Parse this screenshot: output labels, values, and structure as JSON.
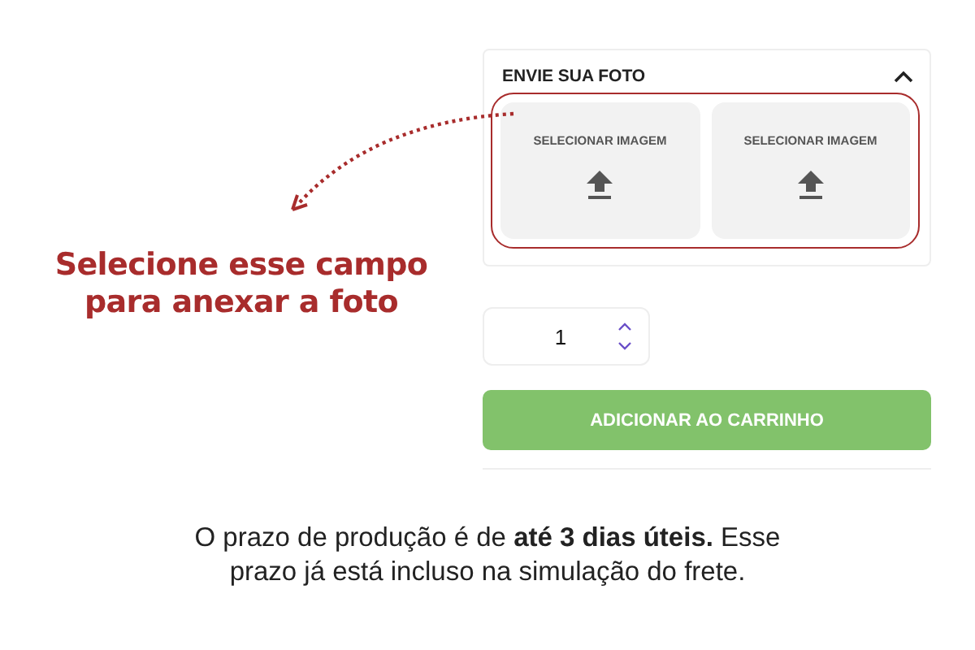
{
  "annotation": {
    "text": "Selecione esse campo para anexar a foto"
  },
  "panel": {
    "title": "ENVIE SUA FOTO",
    "expanded": true,
    "tiles": [
      {
        "label": "SELECIONAR IMAGEM"
      },
      {
        "label": "SELECIONAR IMAGEM"
      }
    ]
  },
  "quantity": {
    "value": "1"
  },
  "add_button": {
    "label": "ADICIONAR AO CARRINHO"
  },
  "note": "O prazo de produção é de **até 3 dias úteis.** Esse prazo já está incluso na simulação do frete."
}
